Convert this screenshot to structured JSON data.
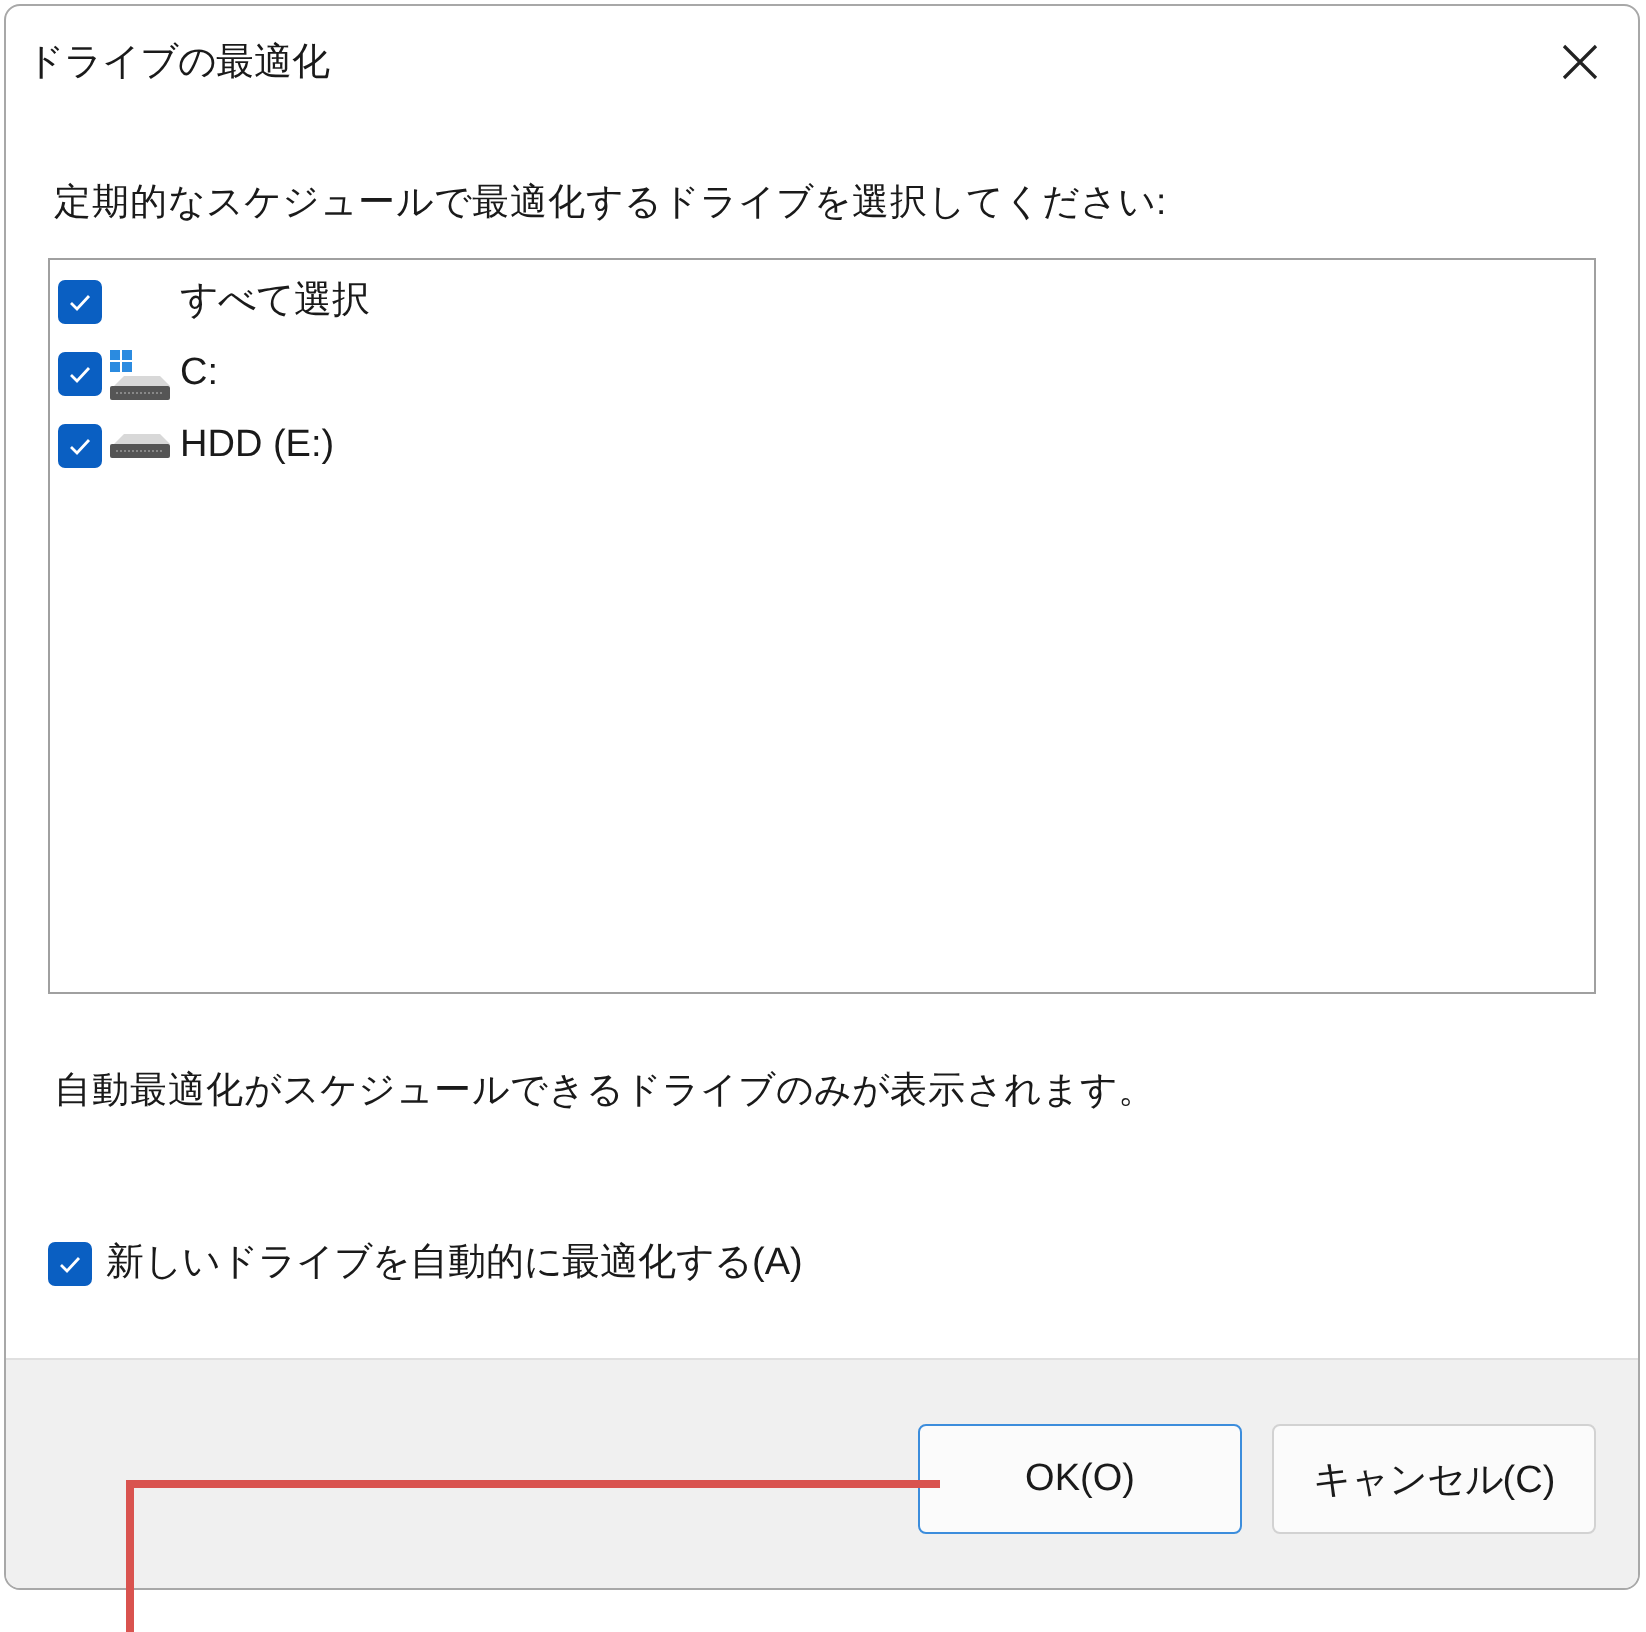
{
  "window": {
    "title": "ドライブの最適化"
  },
  "instruction": "定期的なスケジュールで最適化するドライブを選択してください:",
  "drives": [
    {
      "kind": "all",
      "label": "すべて選択",
      "checked": true
    },
    {
      "kind": "system",
      "label": "C:",
      "checked": true
    },
    {
      "kind": "hdd",
      "label": "HDD (E:)",
      "checked": true
    }
  ],
  "note": "自動最適化がスケジュールできるドライブのみが表示されます。",
  "auto_optimize": {
    "label": "新しいドライブを自動的に最適化する(A)",
    "checked": true
  },
  "buttons": [
    {
      "kind": "default",
      "label": "OK(O)"
    },
    {
      "kind": "normal",
      "label": "キャンセル(C)"
    }
  ]
}
